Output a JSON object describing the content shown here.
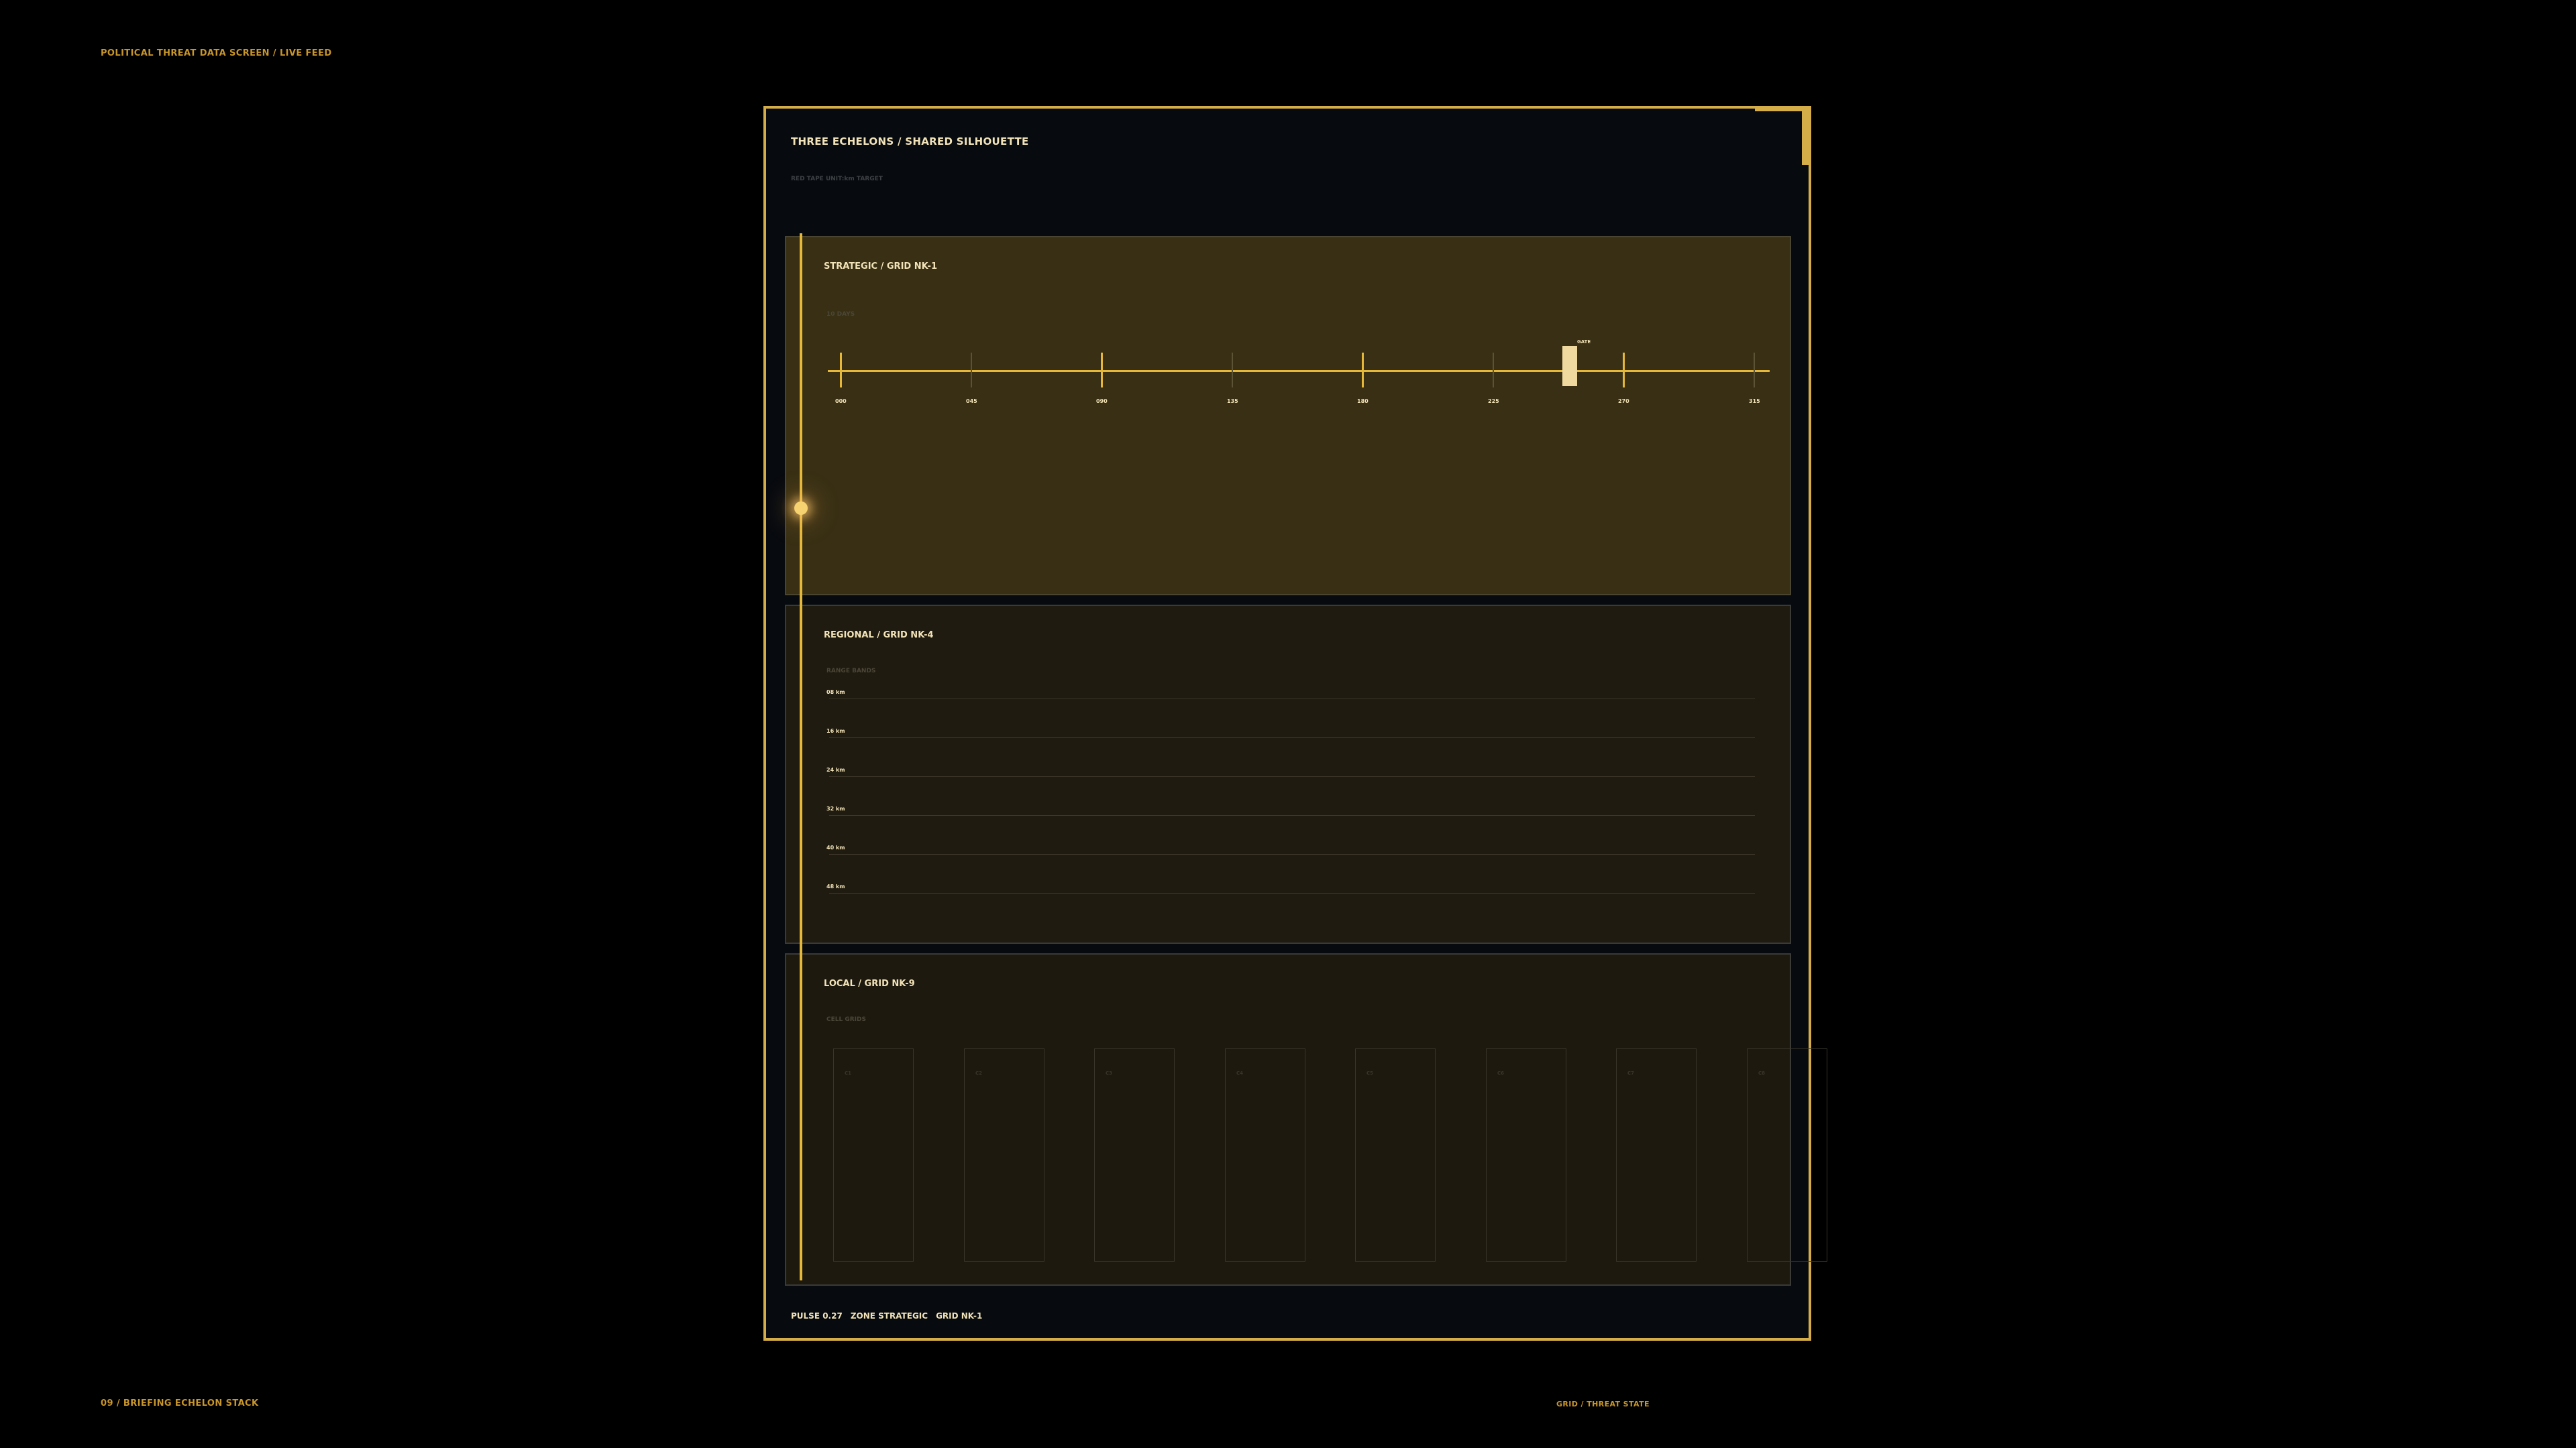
{
  "header": {
    "top_left": "POLITICAL THREAT DATA SCREEN  /  LIVE FEED"
  },
  "footer": {
    "bottom_left": "09 / BRIEFING ECHELON STACK",
    "bottom_right": "GRID  /  THREAT STATE"
  },
  "panel": {
    "title": "THREE ECHELONS  /  SHARED SILHOUETTE",
    "subtitle": "RED TAPE  UNIT:km  TARGET",
    "status": {
      "pulse": "PULSE 0.27",
      "zone": "ZONE STRATEGIC",
      "grid": "GRID NK-1"
    }
  },
  "echelons": {
    "strategic": {
      "title": "STRATEGIC  /  GRID NK-1",
      "sub": "10 DAYS",
      "gate_label": "GATE",
      "ticks": [
        "000",
        "045",
        "090",
        "135",
        "180",
        "225",
        "270",
        "315"
      ]
    },
    "regional": {
      "title": "REGIONAL  /  GRID NK-4",
      "sub": "RANGE BANDS",
      "bands": [
        "08 km",
        "16 km",
        "24 km",
        "32 km",
        "40 km",
        "48 km"
      ]
    },
    "local": {
      "title": "LOCAL  /  GRID NK-9",
      "sub": "CELL GRIDS",
      "cells": [
        "C1",
        "C2",
        "C3",
        "C4",
        "C5",
        "C6",
        "C7",
        "C8"
      ]
    }
  },
  "colors": {
    "accent": "#d4ad49",
    "text": "#f2e3b8",
    "background": "#000000"
  }
}
